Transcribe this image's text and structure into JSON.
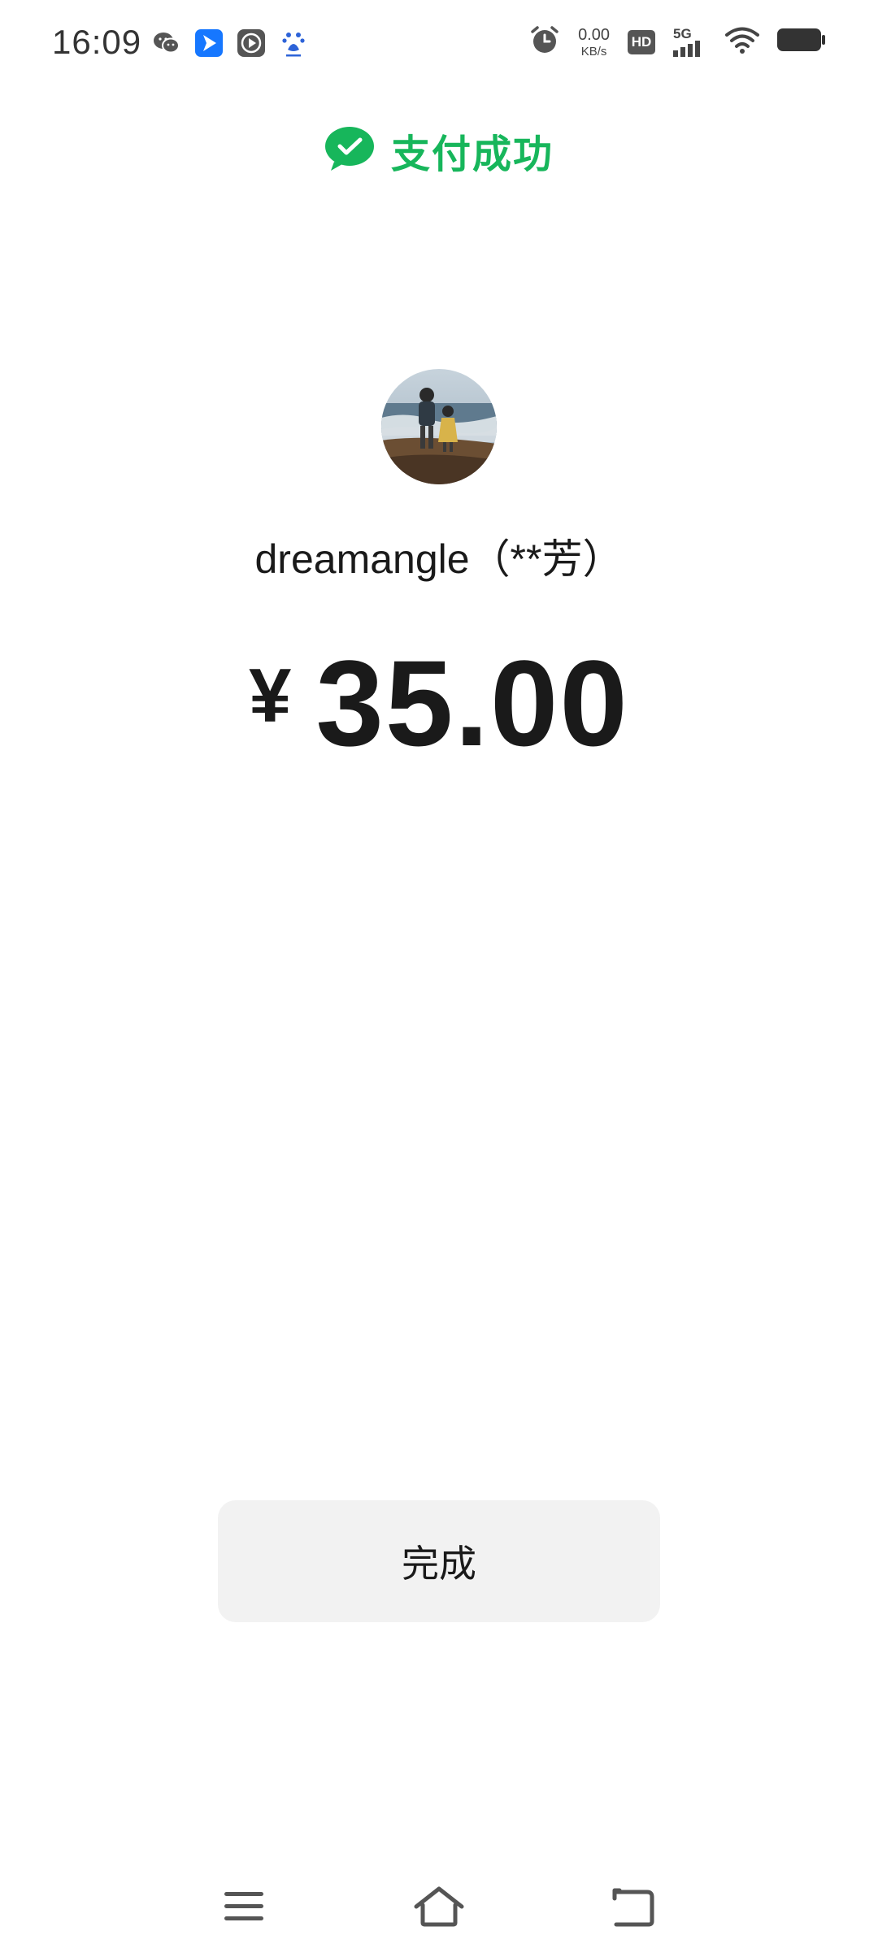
{
  "status_bar": {
    "time": "16:09",
    "net_speed_value": "0.00",
    "net_speed_unit": "KB/s",
    "hd_label": "HD",
    "network_label": "5G"
  },
  "header": {
    "title": "支付成功",
    "accent_color": "#17b65b",
    "icon": "wechat-pay-check-icon"
  },
  "payee": {
    "name": "dreamangle（**芳）"
  },
  "payment": {
    "currency_symbol": "¥",
    "amount": "35.00"
  },
  "actions": {
    "done_label": "完成"
  },
  "nav": {
    "menu_icon": "menu-icon",
    "home_icon": "home-icon",
    "back_icon": "back-icon"
  }
}
